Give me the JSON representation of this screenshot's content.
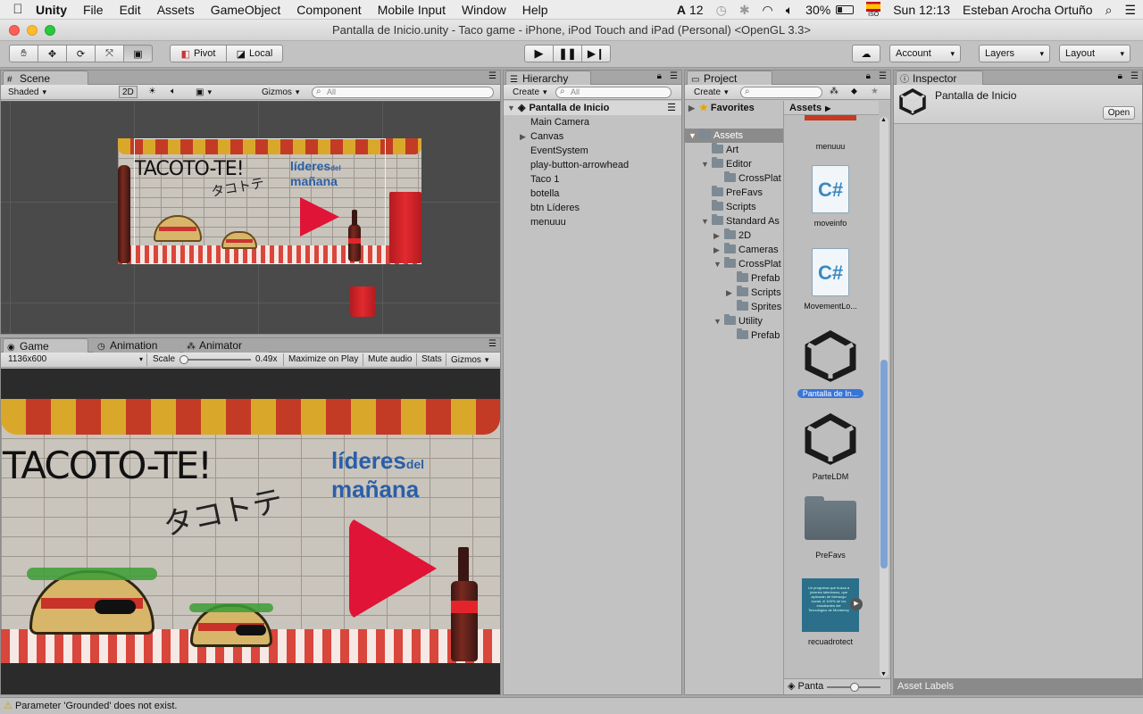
{
  "menubar": {
    "app_name": "Unity",
    "items": [
      "File",
      "Edit",
      "Assets",
      "GameObject",
      "Component",
      "Mobile Input",
      "Window",
      "Help"
    ],
    "adobe_count": "12",
    "battery": "30%",
    "clock": "Sun 12:13",
    "user": "Esteban Arocha Ortuño",
    "input_source": "ISO"
  },
  "window": {
    "title": "Pantalla de Inicio.unity - Taco game - iPhone, iPod Touch and iPad (Personal) <OpenGL 3.3>"
  },
  "toolbar": {
    "pivot": "Pivot",
    "local": "Local",
    "account": "Account",
    "layers": "Layers",
    "layout": "Layout"
  },
  "scene": {
    "tab": "Scene",
    "shading": "Shaded",
    "mode_2d": "2D",
    "gizmos": "Gizmos",
    "search_placeholder": "All",
    "title_text": "TACOTO-TE!",
    "title_jp": "タコトテ",
    "brand_line1": "líderes",
    "brand_small": "del",
    "brand_line2": "mañana"
  },
  "game": {
    "tabs": [
      "Game",
      "Animation",
      "Animator"
    ],
    "resolution": "1136x600",
    "scale_label": "Scale",
    "scale_value": "0.49x",
    "scale_fraction": 0.0,
    "buttons": [
      "Maximize on Play",
      "Mute audio",
      "Stats",
      "Gizmos"
    ],
    "title_text": "TACOTO-TE!",
    "title_jp": "タコトテ",
    "brand_line1": "líderes",
    "brand_small": "del",
    "brand_line2": "mañana"
  },
  "hierarchy": {
    "tab": "Hierarchy",
    "create": "Create",
    "search_placeholder": "All",
    "scene_name": "Pantalla de Inicio",
    "items": [
      "Main Camera",
      "Canvas",
      "EventSystem",
      "play-button-arrowhead",
      "Taco 1",
      "botella",
      "btn Líderes",
      "menuuu"
    ]
  },
  "project": {
    "tab": "Project",
    "create": "Create",
    "favorites": "Favorites",
    "assets_root": "Assets",
    "tree": [
      "Art",
      "Editor",
      "CrossPlat",
      "PreFavs",
      "Scripts",
      "Standard As",
      "2D",
      "Cameras",
      "CrossPlat",
      "Prefab",
      "Scripts",
      "Sprites",
      "Utility",
      "Prefab"
    ],
    "breadcrumb": "Assets",
    "assets": [
      "menuuu",
      "moveinfo",
      "MovementLo...",
      "Pantalla de In...",
      "ParteLDM",
      "PreFavs",
      "recuadrotect"
    ],
    "cs_glyph": "C#",
    "thumb_text": "Un programa que busca a jóvenes talentosos, que aplicarán de liderazgo social, el 100% de los estudiantes del Tecnológico de Monterrey",
    "footer_label": "Panta"
  },
  "inspector": {
    "tab": "Inspector",
    "object_name": "Pantalla de Inicio",
    "open_button": "Open",
    "asset_labels": "Asset Labels"
  },
  "status": {
    "message": "Parameter 'Grounded' does not exist."
  }
}
